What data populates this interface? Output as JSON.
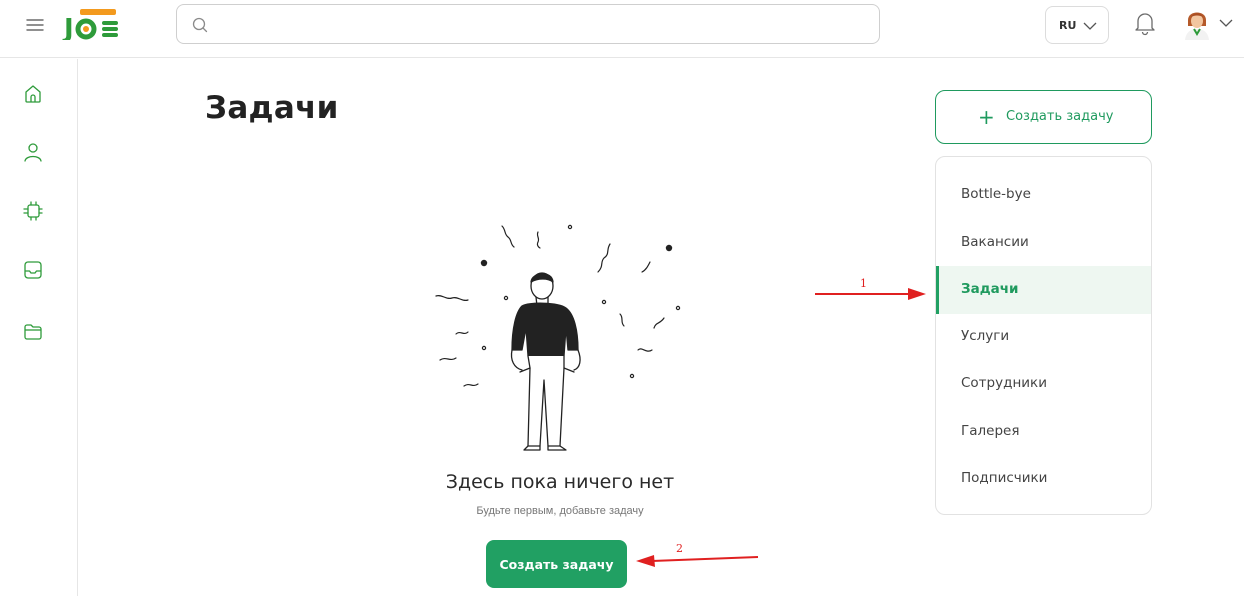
{
  "header": {
    "logo_text": "Jas",
    "logo_tag": "",
    "search": {
      "value": "",
      "placeholder": ""
    },
    "language": "RU",
    "icons": [
      "menu-icon",
      "search-icon",
      "chevron-down-icon",
      "bell-icon",
      "avatar",
      "chevron-down-icon"
    ]
  },
  "sidebar": {
    "items": [
      {
        "icon": "home-icon"
      },
      {
        "icon": "user-icon"
      },
      {
        "icon": "chip-icon"
      },
      {
        "icon": "inbox-icon"
      },
      {
        "icon": "folder-icon"
      }
    ]
  },
  "main": {
    "title": "Задачи",
    "empty": {
      "title": "Здесь пока ничего нет",
      "subtitle": "Будьте первым, добавьте задачу",
      "button": "Создать задачу"
    }
  },
  "right_panel": {
    "create_button": "Создать задачу",
    "nav": [
      {
        "label": "Bottle-bye",
        "active": false
      },
      {
        "label": "Вакансии",
        "active": false
      },
      {
        "label": "Задачи",
        "active": true
      },
      {
        "label": "Услуги",
        "active": false
      },
      {
        "label": "Сотрудники",
        "active": false
      },
      {
        "label": "Галерея",
        "active": false
      },
      {
        "label": "Подписчики",
        "active": false
      }
    ]
  },
  "annotations": {
    "arrow1_label": "1",
    "arrow2_label": "2"
  },
  "colors": {
    "accent": "#21a063",
    "accent_text": "#1f9a5e",
    "annotation": "#e02020",
    "active_bg": "#eef7f1",
    "logo_green": "#2e9b3a",
    "logo_orange": "#f39a1e"
  }
}
